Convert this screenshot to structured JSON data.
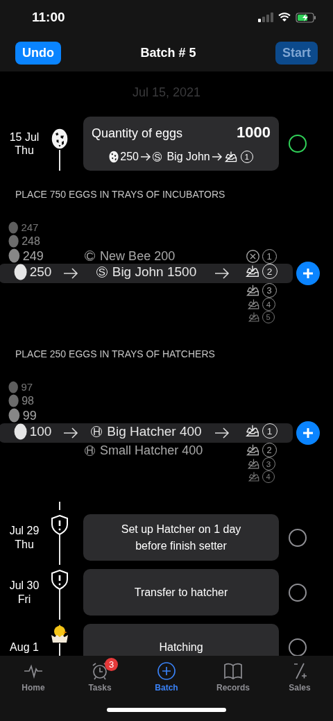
{
  "status_bar": {
    "time": "11:00"
  },
  "nav": {
    "title": "Batch # 5",
    "left_button": {
      "label": "Undo",
      "disabled": false
    },
    "right_button": {
      "label": "Start",
      "disabled": true
    }
  },
  "date_header": "Jul 15, 2021",
  "first_event": {
    "date": "15 Jul",
    "day": "Thu",
    "kind": "egg",
    "title": "Quantity of eggs",
    "value": "1000",
    "summary": {
      "eggs": "250",
      "setter_badge": "S",
      "setter": "Big John",
      "tray": "1"
    },
    "done": true
  },
  "sections": [
    {
      "title": "PLACE 750 EGGS IN TRAYS OF INCUBATORS",
      "picker": {
        "eggs": [
          {
            "label": "247",
            "selected": false
          },
          {
            "label": "248",
            "selected": false
          },
          {
            "label": "249",
            "selected": false
          },
          {
            "label": "250",
            "selected": true
          }
        ],
        "machines": [
          {
            "badge": "C",
            "label": "New Bee 200",
            "selected": false
          },
          {
            "badge": "S",
            "label": "Big John 1500",
            "selected": true
          }
        ],
        "trays": [
          {
            "kind": "remove",
            "number": "1",
            "selected": false
          },
          {
            "kind": "tray",
            "number": "2",
            "selected": true
          },
          {
            "kind": "tray",
            "number": "3",
            "selected": false
          },
          {
            "kind": "tray",
            "number": "4",
            "selected": false
          },
          {
            "kind": "tray",
            "number": "5",
            "selected": false
          }
        ]
      }
    },
    {
      "title": "PLACE 250 EGGS IN TRAYS OF HATCHERS",
      "picker": {
        "eggs": [
          {
            "label": "97",
            "selected": false
          },
          {
            "label": "98",
            "selected": false
          },
          {
            "label": "99",
            "selected": false
          },
          {
            "label": "100",
            "selected": true
          }
        ],
        "machines": [
          {
            "badge": "H",
            "label": "Big Hatcher 400",
            "selected": true
          },
          {
            "badge": "H",
            "label": "Small Hatcher 400",
            "selected": false
          }
        ],
        "trays": [
          {
            "kind": "tray",
            "number": "1",
            "selected": true
          },
          {
            "kind": "tray",
            "number": "2",
            "selected": false
          },
          {
            "kind": "tray",
            "number": "3",
            "selected": false
          },
          {
            "kind": "tray",
            "number": "4",
            "selected": false
          }
        ]
      }
    }
  ],
  "tasks": [
    {
      "date": "Jul 29",
      "day": "Thu",
      "kind": "alert",
      "text": "Set up Hatcher on 1 day before finish setter",
      "done": false
    },
    {
      "date": "Jul 30",
      "day": "Fri",
      "kind": "alert",
      "text": "Transfer to hatcher",
      "done": false
    },
    {
      "date": "Aug 1",
      "kind": "chick",
      "text": "Hatching",
      "done": false
    }
  ],
  "tab_bar": [
    {
      "label": "Home",
      "kind": "pulse",
      "selected": false
    },
    {
      "label": "Tasks",
      "kind": "alarm",
      "selected": false,
      "badge": "3"
    },
    {
      "label": "Batch",
      "kind": "plus-circle",
      "selected": true
    },
    {
      "label": "Records",
      "kind": "book",
      "selected": false
    },
    {
      "label": "Sales",
      "kind": "minus-plus",
      "selected": false
    }
  ]
}
